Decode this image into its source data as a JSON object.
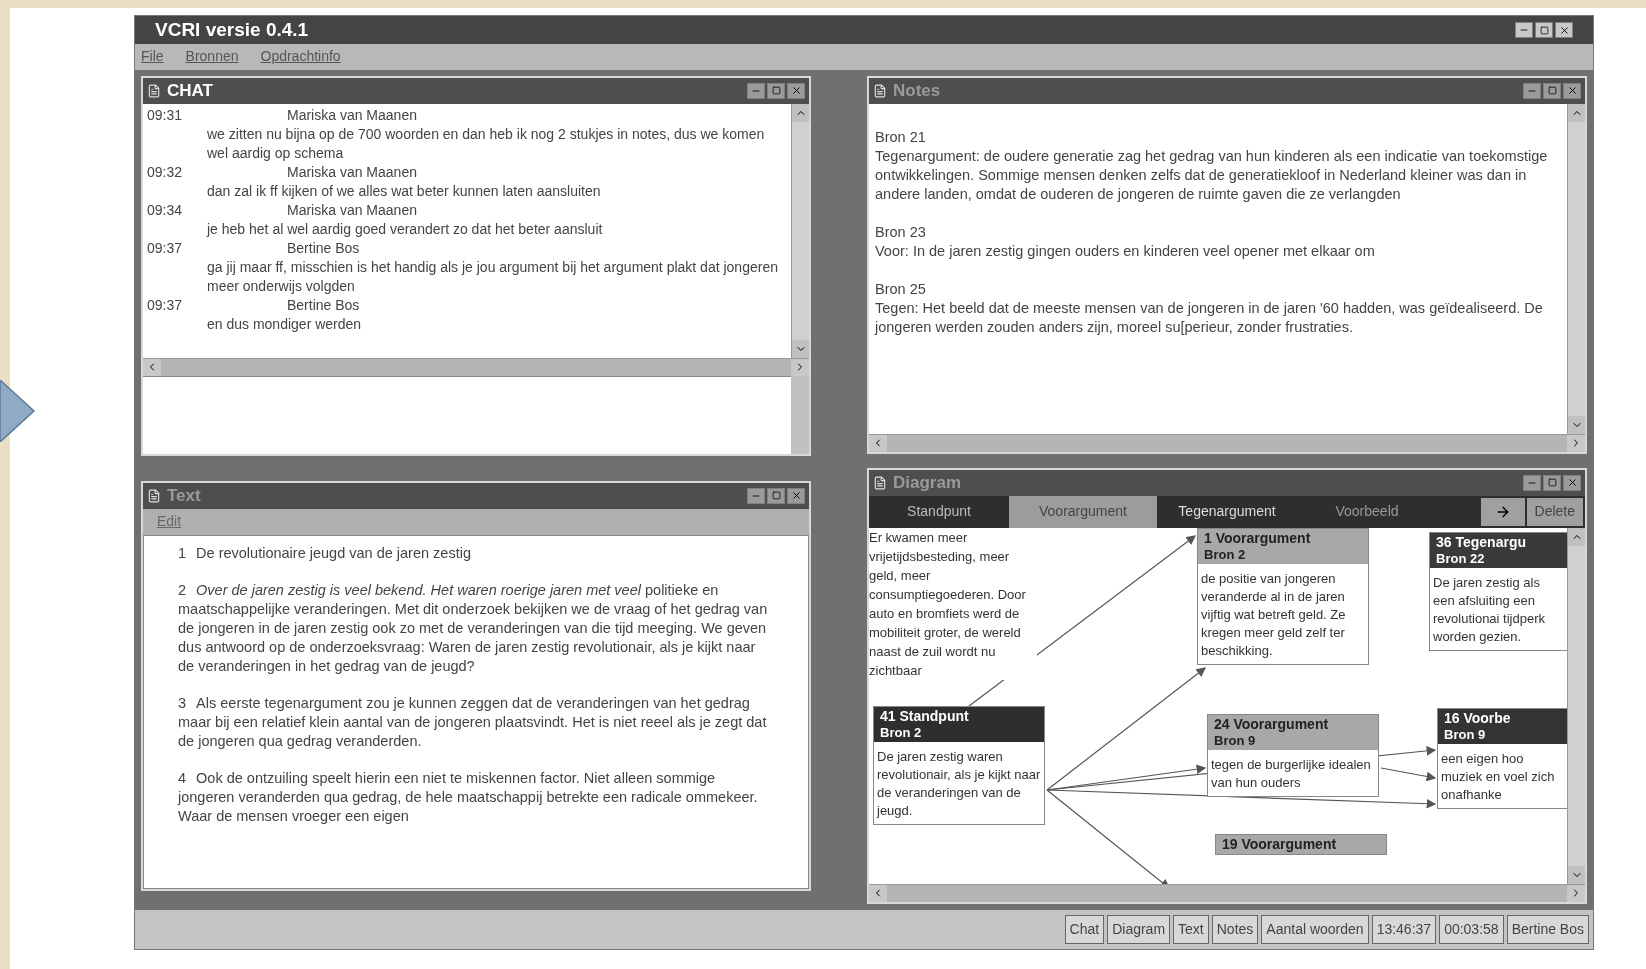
{
  "window": {
    "title": "VCRI versie 0.4.1"
  },
  "menu": [
    "File",
    "Bronnen",
    "Opdrachtinfo"
  ],
  "chat": {
    "title": "CHAT",
    "messages": [
      {
        "time": "09:31",
        "author": "Mariska van Maanen",
        "text": "we zitten nu bijna op de 700 woorden en dan heb ik nog 2 stukjes in notes, dus we komen wel aardig op schema"
      },
      {
        "time": "09:32",
        "author": "Mariska van Maanen",
        "text": "dan zal ik ff kijken of we alles wat beter kunnen laten aansluiten"
      },
      {
        "time": "09:34",
        "author": "Mariska van Maanen",
        "text": "je heb het al wel aardig goed verandert zo dat het beter aansluit"
      },
      {
        "time": "09:37",
        "author": "Bertine Bos",
        "text": "ga jij maar ff, misschien is het handig als je jou argument bij het argument plakt dat jongeren meer onderwijs volgden"
      },
      {
        "time": "09:37",
        "author": "Bertine Bos",
        "text": "en dus mondiger werden"
      }
    ]
  },
  "notes": {
    "title": "Notes",
    "entries": [
      {
        "source": "Bron 21",
        "text": "Tegenargument: de oudere generatie zag het gedrag van hun kinderen als een indicatie van toekomstige ontwikkelingen. Sommige mensen denken zelfs dat de generatiekloof in Nederland kleiner was dan in andere landen, omdat de ouderen de jongeren de ruimte gaven die ze verlangden"
      },
      {
        "source": "Bron 23",
        "text": "Voor: In de jaren zestig gingen ouders en kinderen veel opener met elkaar om"
      },
      {
        "source": "Bron 25",
        "text": "Tegen: Het beeld dat de meeste mensen van de jongeren in de jaren '60 hadden, was geïdealiseerd. De jongeren werden zouden anders zijn, moreel su[perieur, zonder frustraties."
      }
    ]
  },
  "text_window": {
    "title": "Text",
    "menu": [
      "Edit"
    ],
    "paragraphs": [
      {
        "number": "1",
        "text": "De revolutionaire jeugd van de jaren zestig"
      },
      {
        "number": "2",
        "text": "*Over de jaren zestig is veel bekend. Het waren roerige jaren met veel* politieke en maatschappelijke veranderingen. Met dit onderzoek bekijken we de vraag of het gedrag van de jongeren in de jaren zestig ook zo met de veranderingen van die tijd meeging. We geven dus antwoord op de onderzoeksvraag: Waren de jaren zestig revolutionair, als je kijkt naar de veranderingen in het gedrag van de jeugd?"
      },
      {
        "number": "3",
        "text": "Als eerste tegenargument zou je kunnen zeggen dat  de veranderingen van het gedrag maar bij een relatief klein aantal van de jongeren plaatsvindt. Het is niet reeel als je zegt dat de jongeren qua gedrag veranderden."
      },
      {
        "number": "4",
        "text": "Ook de ontzuiling speelt hierin een niet te miskennen factor. Niet alleen sommige jongeren veranderden qua gedrag, de hele maatschappij betrekte een radicale ommekeer. Waar de mensen vroeger een eigen"
      }
    ]
  },
  "diagram": {
    "title": "Diagram",
    "tools": [
      {
        "label": "Standpunt",
        "kind": "standpunt",
        "selected": false
      },
      {
        "label": "Voorargument",
        "kind": "voorargument",
        "selected": true
      },
      {
        "label": "Tegenargument",
        "kind": "tegenargument",
        "selected": false
      },
      {
        "label": "Voorbeeld",
        "kind": "voorbeeld",
        "selected": false
      }
    ],
    "delete_label": "Delete",
    "nodes": [
      {
        "kind": "text",
        "text": "Er kwamen meer vrijetijdsbesteding, meer geld, meer consumptiegoederen. Door auto en bromfiets werd de mobiliteit groter, de wereld naast de zuil wordt nu zichtbaar"
      },
      {
        "kind": "standpunt",
        "title": "41 Standpunt",
        "source": "Bron 2",
        "text": "De jaren zestig waren revolutionair, als je kijkt naar de veranderingen van de jeugd."
      },
      {
        "kind": "voorargument",
        "title": "1 Voorargument",
        "source": "Bron 2",
        "text": "de positie van jongeren veranderde al in de jaren vijftig wat betreft geld. Ze kregen meer geld zelf ter beschikking."
      },
      {
        "kind": "voorargument",
        "title": "24 Voorargument",
        "source": "Bron 9",
        "text": "tegen de burgerlijke idealen van hun ouders"
      },
      {
        "kind": "voorargument",
        "title": "19 Voorargument"
      },
      {
        "kind": "tegenargument",
        "title": "36 Tegenargu",
        "source": "Bron 22",
        "text": "De jaren zestig als een afsluiting een revolutionai tijdperk worden gezien."
      },
      {
        "kind": "voorbeeld",
        "title": "16 Voorbe",
        "source": "Bron 9",
        "text": "een eigen hoo muziek en voel zich onafhanke"
      }
    ]
  },
  "status_bar": {
    "items": [
      "Chat",
      "Diagram",
      "Text",
      "Notes",
      "Aantal woorden",
      "13:46:37",
      "00:03:58",
      "Bertine Bos"
    ]
  }
}
